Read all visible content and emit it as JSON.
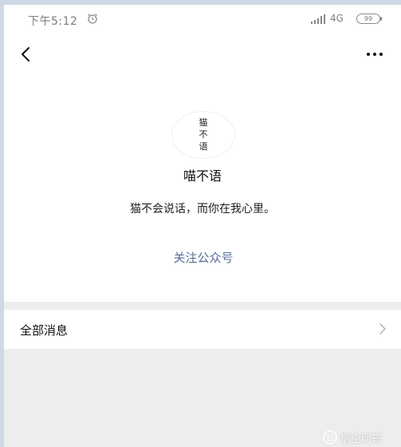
{
  "status_bar": {
    "time": "下午5:12",
    "network": "4G",
    "battery": "99"
  },
  "icons": {
    "back": "back-arrow-icon",
    "more": "more-dots-icon",
    "alarm": "alarm-clock-icon",
    "signal": "signal-bars-icon",
    "chevron": "chevron-right-icon"
  },
  "profile": {
    "avatar_text": "猫\n不\n语",
    "name": "喵不语",
    "description": "猫不会说话，而你在我心里。",
    "follow_label": "关注公众号"
  },
  "messages": {
    "all_label": "全部消息"
  },
  "watermark": {
    "text": "悟空问答"
  },
  "colors": {
    "link": "#576b95",
    "page_bg": "#ededed",
    "card_bg": "#ffffff"
  }
}
